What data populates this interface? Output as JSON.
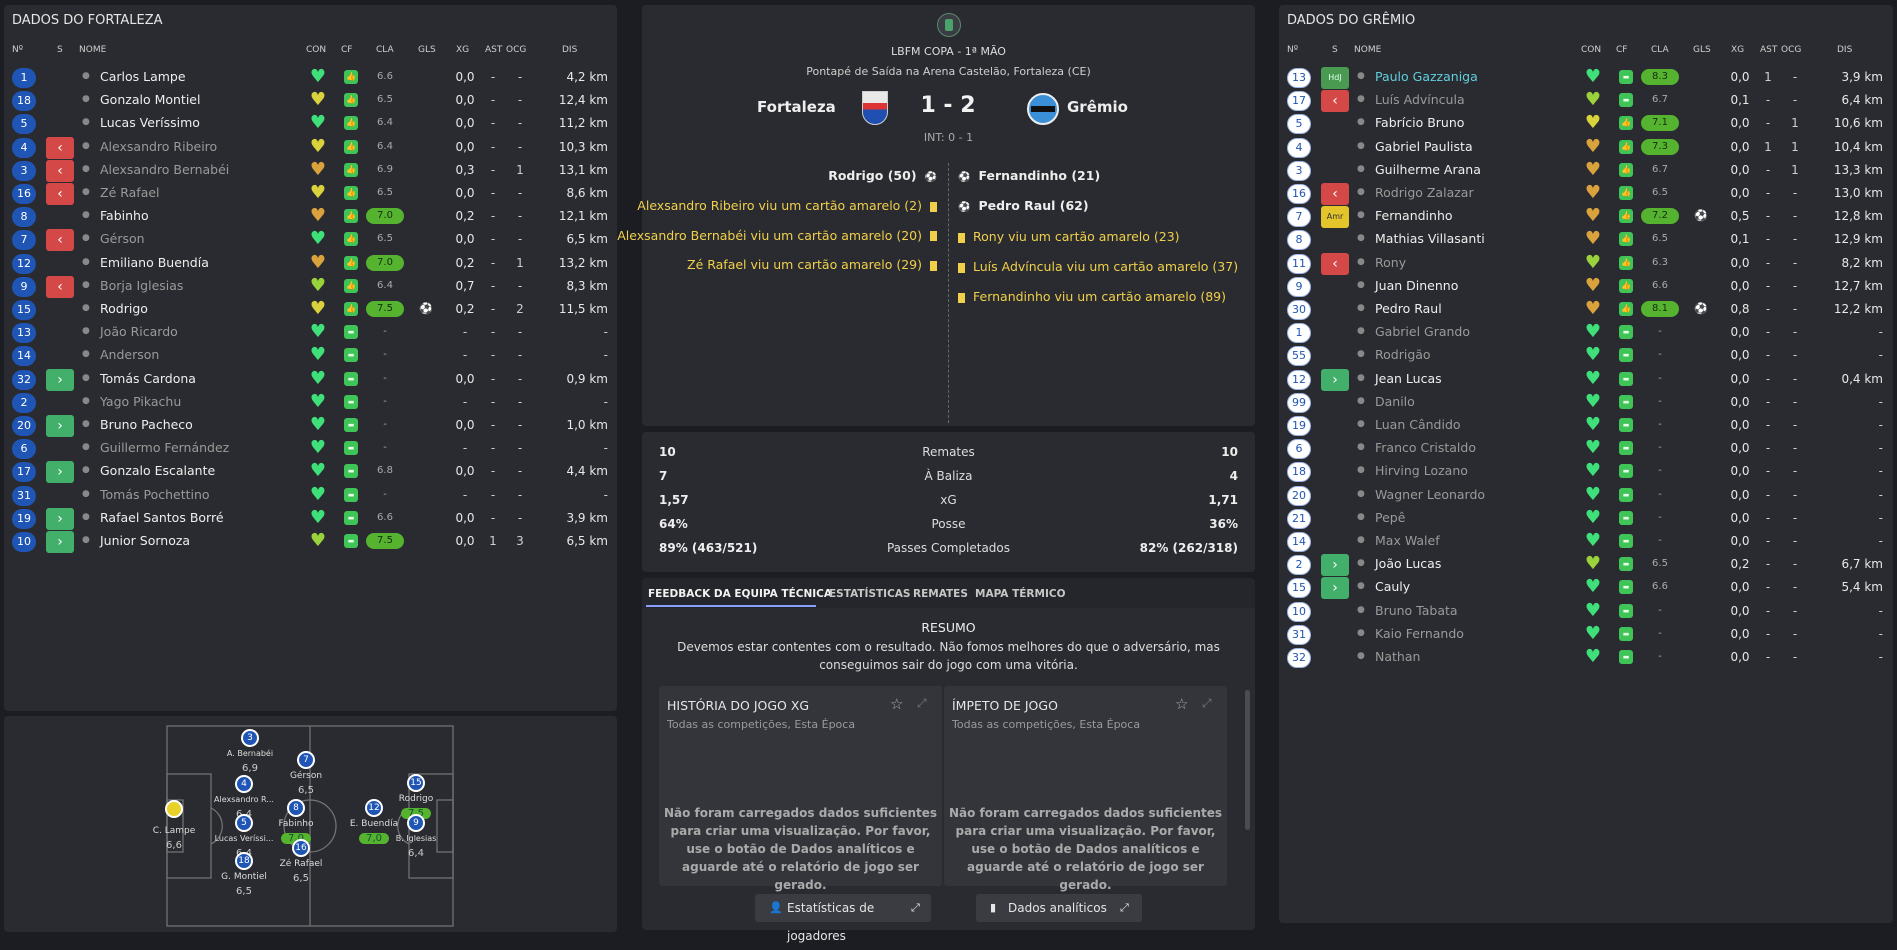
{
  "left": {
    "title": "DADOS DO FORTALEZA",
    "headers": {
      "n": "Nº",
      "s": "S",
      "nome": "NOME",
      "con": "CON",
      "cf": "CF",
      "cla": "CLA",
      "gls": "GLS",
      "xg": "XG",
      "ast": "AST",
      "ocg": "OCG",
      "dis": "DIS"
    },
    "rows": [
      {
        "num": "1",
        "sub": "",
        "name": "Carlos Lampe",
        "dim": false,
        "heart": "#3fe07a",
        "cf": "up",
        "cla": "6.6",
        "cla_green": false,
        "gls": "",
        "xg": "0,0",
        "ast": "-",
        "ocg": "-",
        "dis": "4,2 km"
      },
      {
        "num": "18",
        "sub": "",
        "name": "Gonzalo Montiel",
        "dim": false,
        "heart": "#d9d23c",
        "cf": "up",
        "cla": "6.5",
        "cla_green": false,
        "gls": "",
        "xg": "0,0",
        "ast": "-",
        "ocg": "-",
        "dis": "12,4 km"
      },
      {
        "num": "5",
        "sub": "",
        "name": "Lucas Veríssimo",
        "dim": false,
        "heart": "#3fe07a",
        "cf": "up",
        "cla": "6.4",
        "cla_green": false,
        "gls": "",
        "xg": "0,0",
        "ast": "-",
        "ocg": "-",
        "dis": "11,2 km"
      },
      {
        "num": "4",
        "sub": "out",
        "name": "Alexsandro Ribeiro",
        "dim": true,
        "heart": "#d9d23c",
        "cf": "up",
        "cla": "6.4",
        "cla_green": false,
        "gls": "",
        "xg": "0,0",
        "ast": "-",
        "ocg": "-",
        "dis": "10,3 km"
      },
      {
        "num": "3",
        "sub": "out",
        "name": "Alexsandro Bernabéi",
        "dim": true,
        "heart": "#d9a23c",
        "cf": "up",
        "cla": "6.9",
        "cla_green": false,
        "gls": "",
        "xg": "0,3",
        "ast": "-",
        "ocg": "1",
        "dis": "13,1 km"
      },
      {
        "num": "16",
        "sub": "out",
        "name": "Zé Rafael",
        "dim": true,
        "heart": "#d9d23c",
        "cf": "up",
        "cla": "6.5",
        "cla_green": false,
        "gls": "",
        "xg": "0,0",
        "ast": "-",
        "ocg": "-",
        "dis": "8,6 km"
      },
      {
        "num": "8",
        "sub": "",
        "name": "Fabinho",
        "dim": false,
        "heart": "#d9a23c",
        "cf": "up",
        "cla": "7.0",
        "cla_green": true,
        "gls": "",
        "xg": "0,2",
        "ast": "-",
        "ocg": "-",
        "dis": "12,1 km"
      },
      {
        "num": "7",
        "sub": "out",
        "name": "Gérson",
        "dim": true,
        "heart": "#3fe07a",
        "cf": "up",
        "cla": "6.5",
        "cla_green": false,
        "gls": "",
        "xg": "0,0",
        "ast": "-",
        "ocg": "-",
        "dis": "6,5 km"
      },
      {
        "num": "12",
        "sub": "",
        "name": "Emiliano Buendía",
        "dim": false,
        "heart": "#d9a23c",
        "cf": "up",
        "cla": "7.0",
        "cla_green": true,
        "gls": "",
        "xg": "0,2",
        "ast": "-",
        "ocg": "1",
        "dis": "13,2 km"
      },
      {
        "num": "9",
        "sub": "out",
        "name": "Borja Iglesias",
        "dim": true,
        "heart": "#9ad23c",
        "cf": "up",
        "cla": "6.4",
        "cla_green": false,
        "gls": "",
        "xg": "0,7",
        "ast": "-",
        "ocg": "-",
        "dis": "8,3 km"
      },
      {
        "num": "15",
        "sub": "",
        "name": "Rodrigo",
        "dim": false,
        "heart": "#d9d23c",
        "cf": "up",
        "cla": "7.5",
        "cla_green": true,
        "gls": "⚽",
        "xg": "0,2",
        "ast": "-",
        "ocg": "2",
        "dis": "11,5 km"
      },
      {
        "num": "13",
        "sub": "",
        "name": "João Ricardo",
        "dim": true,
        "heart": "#3fe07a",
        "cf": "eq",
        "cla": "-",
        "cla_green": false,
        "gls": "",
        "xg": "-",
        "ast": "-",
        "ocg": "-",
        "dis": "-"
      },
      {
        "num": "14",
        "sub": "",
        "name": "Anderson",
        "dim": true,
        "heart": "#3fe07a",
        "cf": "eq",
        "cla": "-",
        "cla_green": false,
        "gls": "",
        "xg": "-",
        "ast": "-",
        "ocg": "-",
        "dis": "-"
      },
      {
        "num": "32",
        "sub": "in",
        "name": "Tomás Cardona",
        "dim": false,
        "heart": "#3fe07a",
        "cf": "eq",
        "cla": "-",
        "cla_green": false,
        "gls": "",
        "xg": "0,0",
        "ast": "-",
        "ocg": "-",
        "dis": "0,9 km"
      },
      {
        "num": "2",
        "sub": "",
        "name": "Yago Pikachu",
        "dim": true,
        "heart": "#3fe07a",
        "cf": "eq",
        "cla": "-",
        "cla_green": false,
        "gls": "",
        "xg": "-",
        "ast": "-",
        "ocg": "-",
        "dis": "-"
      },
      {
        "num": "20",
        "sub": "in",
        "name": "Bruno Pacheco",
        "dim": false,
        "heart": "#3fe07a",
        "cf": "eq",
        "cla": "-",
        "cla_green": false,
        "gls": "",
        "xg": "0,0",
        "ast": "-",
        "ocg": "-",
        "dis": "1,0 km"
      },
      {
        "num": "6",
        "sub": "",
        "name": "Guillermo Fernández",
        "dim": true,
        "heart": "#3fe07a",
        "cf": "eq",
        "cla": "-",
        "cla_green": false,
        "gls": "",
        "xg": "-",
        "ast": "-",
        "ocg": "-",
        "dis": "-"
      },
      {
        "num": "17",
        "sub": "in",
        "name": "Gonzalo Escalante",
        "dim": false,
        "heart": "#3fe07a",
        "cf": "eq",
        "cla": "6.8",
        "cla_green": false,
        "gls": "",
        "xg": "0,0",
        "ast": "-",
        "ocg": "-",
        "dis": "4,4 km"
      },
      {
        "num": "31",
        "sub": "",
        "name": "Tomás Pochettino",
        "dim": true,
        "heart": "#3fe07a",
        "cf": "eq",
        "cla": "-",
        "cla_green": false,
        "gls": "",
        "xg": "-",
        "ast": "-",
        "ocg": "-",
        "dis": "-"
      },
      {
        "num": "19",
        "sub": "in",
        "name": "Rafael Santos Borré",
        "dim": false,
        "heart": "#3fe07a",
        "cf": "eq",
        "cla": "6.6",
        "cla_green": false,
        "gls": "",
        "xg": "0,0",
        "ast": "-",
        "ocg": "-",
        "dis": "3,9 km"
      },
      {
        "num": "10",
        "sub": "in",
        "name": "Junior Sornoza",
        "dim": false,
        "heart": "#9ad23c",
        "cf": "eq",
        "cla": "7.5",
        "cla_green": true,
        "gls": "",
        "xg": "0,0",
        "ast": "1",
        "ocg": "3",
        "dis": "6,5 km"
      }
    ]
  },
  "right": {
    "title": "DADOS DO GRÊMIO",
    "headers": {
      "n": "Nº",
      "s": "S",
      "nome": "NOME",
      "con": "CON",
      "cf": "CF",
      "cla": "CLA",
      "gls": "GLS",
      "xg": "XG",
      "ast": "AST",
      "ocg": "OCG",
      "dis": "DIS"
    },
    "rows": [
      {
        "num": "13",
        "sub": "hdj",
        "sublbl": "HdJ",
        "name": "Paulo Gazzaniga",
        "dim": false,
        "cy": true,
        "heart": "#3fe07a",
        "cf": "eq",
        "cla": "8.3",
        "cla_green": true,
        "gls": "",
        "xg": "0,0",
        "ast": "1",
        "ocg": "-",
        "dis": "3,9 km"
      },
      {
        "num": "17",
        "sub": "out",
        "name": "Luís Advíncula",
        "dim": true,
        "heart": "#9ad23c",
        "cf": "eq",
        "cla": "6.7",
        "cla_green": false,
        "gls": "",
        "xg": "0,1",
        "ast": "-",
        "ocg": "-",
        "dis": "6,4 km"
      },
      {
        "num": "5",
        "sub": "",
        "name": "Fabrício Bruno",
        "dim": false,
        "heart": "#d9d23c",
        "cf": "up",
        "cla": "7.1",
        "cla_green": true,
        "gls": "",
        "xg": "0,0",
        "ast": "-",
        "ocg": "1",
        "dis": "10,6 km"
      },
      {
        "num": "4",
        "sub": "",
        "name": "Gabriel Paulista",
        "dim": false,
        "heart": "#d9a23c",
        "cf": "up",
        "cla": "7.3",
        "cla_green": true,
        "gls": "",
        "xg": "0,0",
        "ast": "1",
        "ocg": "1",
        "dis": "10,4 km"
      },
      {
        "num": "3",
        "sub": "",
        "name": "Guilherme Arana",
        "dim": false,
        "heart": "#d9a23c",
        "cf": "up",
        "cla": "6.7",
        "cla_green": false,
        "gls": "",
        "xg": "0,0",
        "ast": "-",
        "ocg": "1",
        "dis": "13,3 km"
      },
      {
        "num": "16",
        "sub": "out",
        "name": "Rodrigo Zalazar",
        "dim": true,
        "heart": "#d9a23c",
        "cf": "up",
        "cla": "6.5",
        "cla_green": false,
        "gls": "",
        "xg": "0,0",
        "ast": "-",
        "ocg": "-",
        "dis": "13,0 km"
      },
      {
        "num": "7",
        "sub": "amr",
        "sublbl": "Amr",
        "name": "Fernandinho",
        "dim": false,
        "heart": "#d9a23c",
        "cf": "up",
        "cla": "7.2",
        "cla_green": true,
        "gls": "⚽",
        "xg": "0,5",
        "ast": "-",
        "ocg": "-",
        "dis": "12,8 km"
      },
      {
        "num": "8",
        "sub": "",
        "name": "Mathias Villasanti",
        "dim": false,
        "heart": "#d9a23c",
        "cf": "up",
        "cla": "6.5",
        "cla_green": false,
        "gls": "",
        "xg": "0,1",
        "ast": "-",
        "ocg": "-",
        "dis": "12,9 km"
      },
      {
        "num": "11",
        "sub": "out",
        "name": "Rony",
        "dim": true,
        "heart": "#9ad23c",
        "cf": "up",
        "cla": "6.3",
        "cla_green": false,
        "gls": "",
        "xg": "0,0",
        "ast": "-",
        "ocg": "-",
        "dis": "8,2 km"
      },
      {
        "num": "9",
        "sub": "",
        "name": "Juan Dinenno",
        "dim": false,
        "heart": "#d9a23c",
        "cf": "up",
        "cla": "6.6",
        "cla_green": false,
        "gls": "",
        "xg": "0,0",
        "ast": "-",
        "ocg": "-",
        "dis": "12,7 km"
      },
      {
        "num": "30",
        "sub": "",
        "name": "Pedro Raul",
        "dim": false,
        "heart": "#d9a23c",
        "cf": "up",
        "cla": "8.1",
        "cla_green": true,
        "gls": "⚽",
        "xg": "0,8",
        "ast": "-",
        "ocg": "-",
        "dis": "12,2 km"
      },
      {
        "num": "1",
        "sub": "",
        "name": "Gabriel Grando",
        "dim": true,
        "heart": "#3fe07a",
        "cf": "eq",
        "cla": "-",
        "cla_green": false,
        "gls": "",
        "xg": "0,0",
        "ast": "-",
        "ocg": "-",
        "dis": "-"
      },
      {
        "num": "55",
        "sub": "",
        "name": "Rodrigão",
        "dim": true,
        "heart": "#3fe07a",
        "cf": "eq",
        "cla": "-",
        "cla_green": false,
        "gls": "",
        "xg": "0,0",
        "ast": "-",
        "ocg": "-",
        "dis": "-"
      },
      {
        "num": "12",
        "sub": "in",
        "name": "Jean Lucas",
        "dim": false,
        "heart": "#3fe07a",
        "cf": "eq",
        "cla": "-",
        "cla_green": false,
        "gls": "",
        "xg": "0,0",
        "ast": "-",
        "ocg": "-",
        "dis": "0,4 km"
      },
      {
        "num": "99",
        "sub": "",
        "name": "Danilo",
        "dim": true,
        "heart": "#3fe07a",
        "cf": "eq",
        "cla": "-",
        "cla_green": false,
        "gls": "",
        "xg": "0,0",
        "ast": "-",
        "ocg": "-",
        "dis": "-"
      },
      {
        "num": "19",
        "sub": "",
        "name": "Luan Cândido",
        "dim": true,
        "heart": "#3fe07a",
        "cf": "eq",
        "cla": "-",
        "cla_green": false,
        "gls": "",
        "xg": "0,0",
        "ast": "-",
        "ocg": "-",
        "dis": "-"
      },
      {
        "num": "6",
        "sub": "",
        "name": "Franco Cristaldo",
        "dim": true,
        "heart": "#3fe07a",
        "cf": "eq",
        "cla": "-",
        "cla_green": false,
        "gls": "",
        "xg": "0,0",
        "ast": "-",
        "ocg": "-",
        "dis": "-"
      },
      {
        "num": "18",
        "sub": "",
        "name": "Hirving Lozano",
        "dim": true,
        "heart": "#3fe07a",
        "cf": "eq",
        "cla": "-",
        "cla_green": false,
        "gls": "",
        "xg": "0,0",
        "ast": "-",
        "ocg": "-",
        "dis": "-"
      },
      {
        "num": "20",
        "sub": "",
        "name": "Wagner Leonardo",
        "dim": true,
        "heart": "#3fe07a",
        "cf": "eq",
        "cla": "-",
        "cla_green": false,
        "gls": "",
        "xg": "0,0",
        "ast": "-",
        "ocg": "-",
        "dis": "-"
      },
      {
        "num": "21",
        "sub": "",
        "name": "Pepê",
        "dim": true,
        "heart": "#3fe07a",
        "cf": "eq",
        "cla": "-",
        "cla_green": false,
        "gls": "",
        "xg": "0,0",
        "ast": "-",
        "ocg": "-",
        "dis": "-"
      },
      {
        "num": "14",
        "sub": "",
        "name": "Max Walef",
        "dim": true,
        "heart": "#3fe07a",
        "cf": "eq",
        "cla": "-",
        "cla_green": false,
        "gls": "",
        "xg": "0,0",
        "ast": "-",
        "ocg": "-",
        "dis": "-"
      },
      {
        "num": "2",
        "sub": "in",
        "name": "João Lucas",
        "dim": false,
        "heart": "#9ad23c",
        "cf": "eq",
        "cla": "6.5",
        "cla_green": false,
        "gls": "",
        "xg": "0,2",
        "ast": "-",
        "ocg": "-",
        "dis": "6,7 km"
      },
      {
        "num": "15",
        "sub": "in",
        "name": "Cauly",
        "dim": false,
        "heart": "#3fe07a",
        "cf": "eq",
        "cla": "6.6",
        "cla_green": false,
        "gls": "",
        "xg": "0,0",
        "ast": "-",
        "ocg": "-",
        "dis": "5,4 km"
      },
      {
        "num": "10",
        "sub": "",
        "name": "Bruno Tabata",
        "dim": true,
        "heart": "#3fe07a",
        "cf": "eq",
        "cla": "-",
        "cla_green": false,
        "gls": "",
        "xg": "0,0",
        "ast": "-",
        "ocg": "-",
        "dis": "-"
      },
      {
        "num": "31",
        "sub": "",
        "name": "Kaio Fernando",
        "dim": true,
        "heart": "#3fe07a",
        "cf": "eq",
        "cla": "-",
        "cla_green": false,
        "gls": "",
        "xg": "0,0",
        "ast": "-",
        "ocg": "-",
        "dis": "-"
      },
      {
        "num": "32",
        "sub": "",
        "name": "Nathan",
        "dim": true,
        "heart": "#3fe07a",
        "cf": "eq",
        "cla": "-",
        "cla_green": false,
        "gls": "",
        "xg": "0,0",
        "ast": "-",
        "ocg": "-",
        "dis": "-"
      }
    ]
  },
  "match": {
    "competition": "LBFM COPA - 1ª MÃO",
    "venue": "Pontapé de Saída na Arena Castelão, Fortaleza (CE)",
    "home": "Fortaleza",
    "away": "Grêmio",
    "score": "1 - 2",
    "half": "INT: 0 - 1",
    "home_events": [
      {
        "text": "Rodrigo (50)",
        "type": "goal"
      },
      {
        "text": "Alexsandro Ribeiro viu um cartão amarelo (2)",
        "type": "yellow"
      },
      {
        "text": "Alexsandro Bernabéi viu um cartão amarelo (20)",
        "type": "yellow"
      },
      {
        "text": "Zé Rafael viu um cartão amarelo (29)",
        "type": "yellow"
      }
    ],
    "away_events": [
      {
        "text": "Fernandinho (21)",
        "type": "goal"
      },
      {
        "text": "Pedro Raul (62)",
        "type": "goal"
      },
      {
        "text": "Rony viu um cartão amarelo (23)",
        "type": "yellow"
      },
      {
        "text": "Luís Advíncula viu um cartão amarelo (37)",
        "type": "yellow"
      },
      {
        "text": "Fernandinho viu um cartão amarelo (89)",
        "type": "yellow"
      }
    ]
  },
  "stats": [
    {
      "home": "10",
      "label": "Remates",
      "away": "10"
    },
    {
      "home": "7",
      "label": "À Baliza",
      "away": "4"
    },
    {
      "home": "1,57",
      "label": "xG",
      "away": "1,71"
    },
    {
      "home": "64%",
      "label": "Posse",
      "away": "36%"
    },
    {
      "home": "89% (463/521)",
      "label": "Passes Completados",
      "away": "82% (262/318)"
    }
  ],
  "feedback": {
    "tabs": [
      "FEEDBACK DA EQUIPA TÉCNICA",
      "ESTATÍSTICAS",
      "REMATES",
      "MAPA TÉRMICO"
    ],
    "summary_title": "RESUMO",
    "summary_l1": "Devemos estar contentes com o resultado. Não fomos melhores do que o adversário, mas",
    "summary_l2": "conseguimos sair do jogo com uma vitória.",
    "cards": [
      {
        "title": "HISTÓRIA DO JOGO XG",
        "sub": "Todas as competições, Esta Época",
        "body": [
          "Não foram carregados dados suficientes",
          "para criar uma visualização. Por favor,",
          "use o botão de Dados analíticos e",
          "aguarde até o relatório de jogo ser",
          "gerado."
        ]
      },
      {
        "title": "ÍMPETO DE JOGO",
        "sub": "Todas as competições, Esta Época",
        "body": [
          "Não foram carregados dados suficientes",
          "para criar uma visualização. Por favor,",
          "use o botão de Dados analíticos e",
          "aguarde até o relatório de jogo ser",
          "gerado."
        ]
      }
    ],
    "btn_players": "Estatísticas de jogadores",
    "btn_analytics": "Dados analíticos"
  },
  "pitch": [
    {
      "num": "",
      "name": "C. Lampe",
      "rating": "6,6",
      "green": false,
      "gk": true
    },
    {
      "num": "3",
      "name": "A. Bernabéi",
      "rating": "6,9",
      "green": false
    },
    {
      "num": "4",
      "name": "Alexsandro R...",
      "rating": "6,4",
      "green": false
    },
    {
      "num": "5",
      "name": "Lucas Veríssi...",
      "rating": "6,4",
      "green": false
    },
    {
      "num": "18",
      "name": "G. Montiel",
      "rating": "6,5",
      "green": false
    },
    {
      "num": "7",
      "name": "Gérson",
      "rating": "6,5",
      "green": false
    },
    {
      "num": "8",
      "name": "Fabinho",
      "rating": "7,0",
      "green": true
    },
    {
      "num": "16",
      "name": "Zé Rafael",
      "rating": "6,5",
      "green": false
    },
    {
      "num": "12",
      "name": "E. Buendía",
      "rating": "7,0",
      "green": true
    },
    {
      "num": "15",
      "name": "Rodrigo",
      "rating": "7,5",
      "green": true
    },
    {
      "num": "9",
      "name": "B. Iglesias",
      "rating": "6,4",
      "green": false
    }
  ]
}
